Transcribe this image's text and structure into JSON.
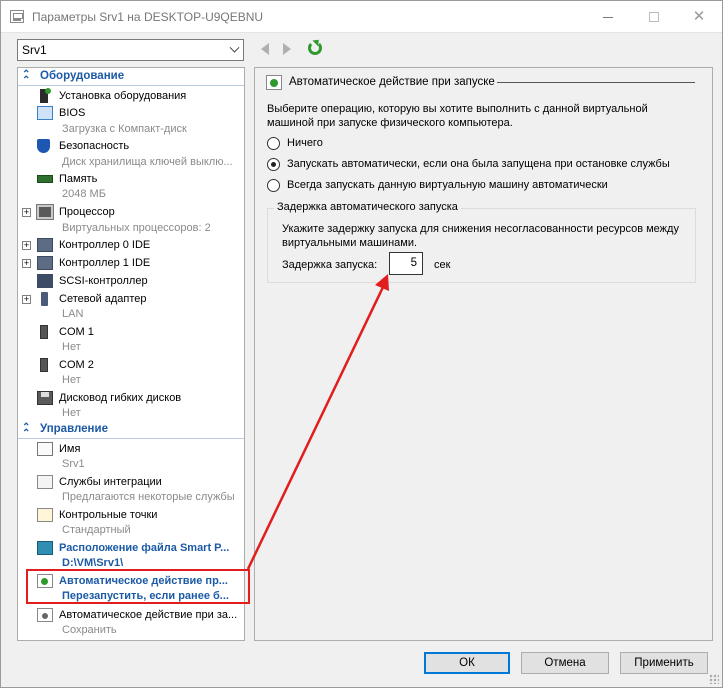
{
  "window": {
    "title": "Параметры Srv1 на DESKTOP-U9QEBNU"
  },
  "toolbar": {
    "vm_selected": "Srv1"
  },
  "tree": {
    "hardware_header": "Оборудование",
    "management_header": "Управление",
    "items": [
      {
        "label": "Установка оборудования",
        "sub": ""
      },
      {
        "label": "BIOS",
        "sub": "Загрузка с Компакт-диск"
      },
      {
        "label": "Безопасность",
        "sub": "Диск хранилища ключей выклю..."
      },
      {
        "label": "Память",
        "sub": "2048 МБ"
      },
      {
        "label": "Процессор",
        "sub": "Виртуальных процессоров: 2"
      },
      {
        "label": "Контроллер 0 IDE",
        "sub": ""
      },
      {
        "label": "Контроллер 1 IDE",
        "sub": ""
      },
      {
        "label": "SCSI-контроллер",
        "sub": ""
      },
      {
        "label": "Сетевой адаптер",
        "sub": "LAN"
      },
      {
        "label": "COM 1",
        "sub": "Нет"
      },
      {
        "label": "COM 2",
        "sub": "Нет"
      },
      {
        "label": "Дисковод гибких дисков",
        "sub": "Нет"
      },
      {
        "label": "Имя",
        "sub": "Srv1"
      },
      {
        "label": "Службы интеграции",
        "sub": "Предлагаются некоторые службы"
      },
      {
        "label": "Контрольные точки",
        "sub": "Стандартный"
      },
      {
        "label": "Расположение файла Smart P...",
        "sub": "D:\\VM\\Srv1\\"
      },
      {
        "label": "Автоматическое действие пр...",
        "sub": "Перезапустить, если ранее б..."
      },
      {
        "label": "Автоматическое действие при за...",
        "sub": "Сохранить"
      }
    ]
  },
  "panel": {
    "title": "Автоматическое действие при запуске",
    "description": "Выберите операцию, которую вы хотите выполнить с данной виртуальной машиной при запуске физического компьютера.",
    "options": [
      {
        "label": "Ничего",
        "selected": false
      },
      {
        "label": "Запускать автоматически, если она была запущена при остановке службы",
        "selected": true
      },
      {
        "label": "Всегда запускать данную виртуальную машину автоматически",
        "selected": false
      }
    ],
    "group": {
      "legend": "Задержка автоматического запуска",
      "text": "Укажите задержку запуска для снижения несогласованности ресурсов между виртуальными машинами.",
      "delay_label": "Задержка запуска:",
      "delay_value": "5",
      "delay_unit": "сек"
    }
  },
  "footer": {
    "ok": "ОК",
    "cancel": "Отмена",
    "apply": "Применить"
  },
  "colors": {
    "accent": "#1c5aa6",
    "annotation": "#e11d1d",
    "focus": "#0078d7"
  }
}
